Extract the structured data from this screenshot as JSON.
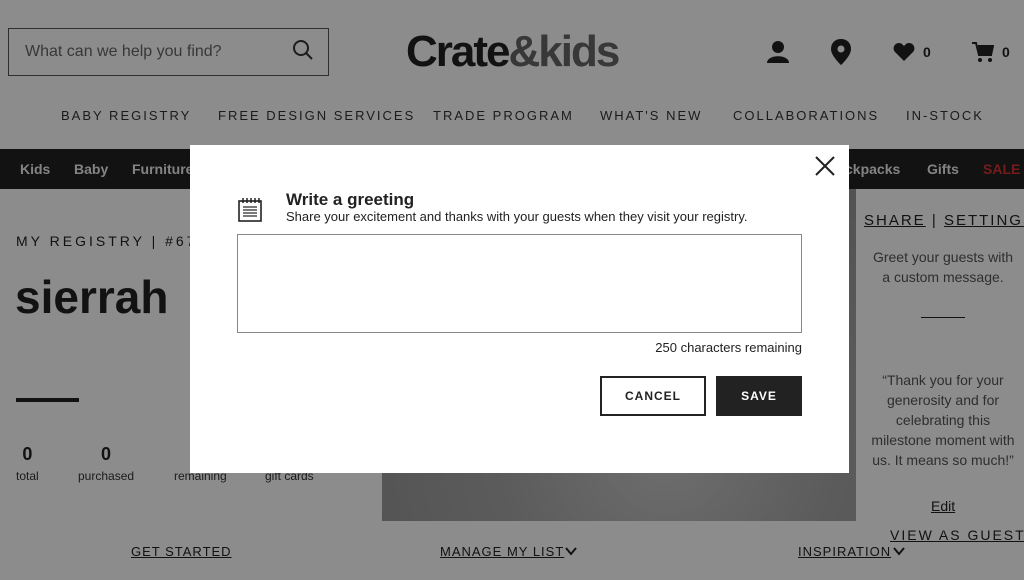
{
  "header": {
    "search_placeholder": "What can we help you find?",
    "logo_part1": "Crate",
    "logo_part2": "&kids",
    "favorites_count": "0",
    "cart_count": "0"
  },
  "top_nav": [
    "BABY REGISTRY",
    "FREE DESIGN SERVICES",
    "TRADE PROGRAM",
    "WHAT'S NEW",
    "COLLABORATIONS",
    "IN-STOCK"
  ],
  "category_bar": {
    "items": [
      "Kids",
      "Baby",
      "Furniture",
      "ckpacks",
      "Gifts"
    ],
    "sale": "SALE",
    "sale_color": "#d33333"
  },
  "registry": {
    "number_label": "MY REGISTRY | #67",
    "name": "sierrah",
    "stats": [
      {
        "value": "0",
        "label": "total"
      },
      {
        "value": "0",
        "label": "purchased"
      },
      {
        "value": "",
        "label": "remaining"
      },
      {
        "value": "",
        "label": "gift cards"
      }
    ]
  },
  "sidebar": {
    "share": "SHARE",
    "separator": "|",
    "settings": "SETTINGS",
    "greet_text": "Greet your guests with a custom message.",
    "quote": "“Thank you for your generosity and for celebrating this milestone moment with us. It means so much!”",
    "edit": "Edit",
    "view_as_guest": "VIEW AS GUEST"
  },
  "bottom_nav": {
    "get_started": "GET STARTED",
    "manage_list": "MANAGE MY LIST",
    "inspiration": "INSPIRATION"
  },
  "modal": {
    "title": "Write a greeting",
    "subtitle": "Share your excitement and thanks with your guests when they visit your registry.",
    "textarea_value": "",
    "chars_remaining": "250 characters remaining",
    "cancel_label": "CANCEL",
    "save_label": "SAVE",
    "icons": [
      "notepad-icon",
      "close-icon"
    ]
  }
}
